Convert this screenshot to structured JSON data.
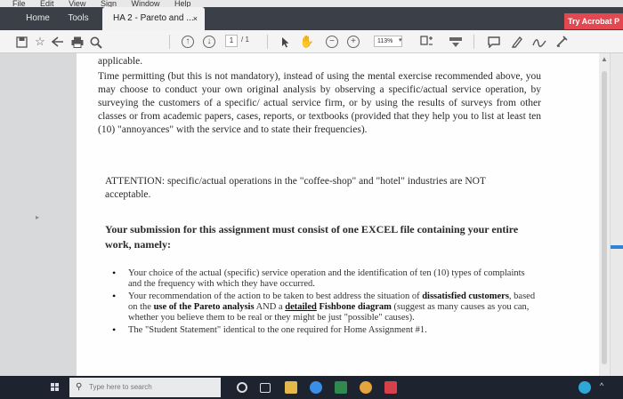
{
  "menu": [
    "File",
    "Edit",
    "View",
    "Sign",
    "Window",
    "Help"
  ],
  "tabs": {
    "home": "Home",
    "tools": "Tools",
    "document": "HA 2 - Pareto and ...",
    "close_glyph": "×",
    "try_acrobat": "Try Acrobat P"
  },
  "toolbar": {
    "page_current": "1",
    "page_total": "/ 1",
    "zoom": "113%"
  },
  "document": {
    "applicable": "applicable.",
    "time_para": "Time permitting (but this is not mandatory), instead of using the mental exercise recommended above, you may choose to conduct your own original analysis by observing a specific/actual service operation, by surveying the customers of a specific/ actual service firm, or by using the results of surveys from other classes or from academic papers, cases, reports, or textbooks (provided that they help you to list at least ten (10) \"annoyances\" with the service and to state their frequencies).",
    "attention_label": "ATTENTION",
    "attention_text": ": specific/actual operations in the \"coffee-shop\" and \"hotel\" industries are NOT acceptable.",
    "submission": "Your submission for this assignment must consist of one EXCEL file containing your entire work, namely:",
    "bullet1": "Your choice of the actual (specific) service operation and the identification of ten (10) types of complaints and the frequency with which they have occurred.",
    "bullet2_a": "Your recommendation of the action to be taken to best address the situation of ",
    "bullet2_b": "dissatisfied customers",
    "bullet2_c": ", based on the ",
    "bullet2_d": "use of the Pareto analysis",
    "bullet2_e": " AND a ",
    "bullet2_f": "detailed",
    "bullet2_g": " ",
    "bullet2_h": "Fishbone diagram",
    "bullet2_i": " (suggest as many causes as you can, whether you believe them to be real or they might be just \"possible\" causes).",
    "bullet3": "The \"Student Statement\" identical to the one required for Home Assignment #1."
  },
  "taskbar": {
    "search_placeholder": "Type here to search"
  },
  "colors": {
    "tab_bar": "#3b3f47",
    "try_acrobat": "#e34850",
    "taskbar": "#1d2430",
    "accent_blue": "#2e82d8"
  }
}
